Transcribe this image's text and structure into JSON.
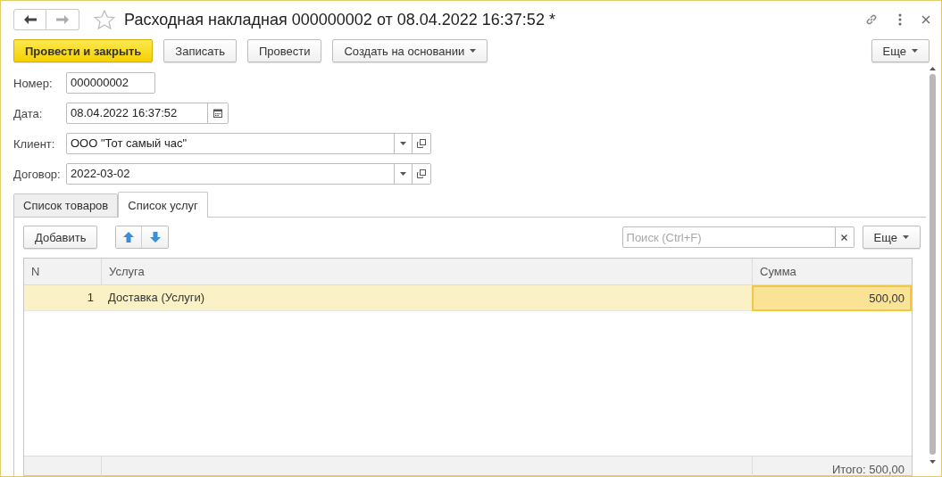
{
  "window": {
    "title": "Расходная накладная 000000002 от 08.04.2022 16:37:52 *"
  },
  "toolbar": {
    "buttons": [
      {
        "label": "Провести и закрыть",
        "kind": "primary"
      },
      {
        "label": "Записать",
        "kind": "plain"
      },
      {
        "label": "Провести",
        "kind": "plain"
      },
      {
        "label": "Создать на основании",
        "kind": "menu"
      }
    ],
    "more": "Еще"
  },
  "fields": [
    {
      "label": "Номер:",
      "value": "000000002",
      "kind": "text"
    },
    {
      "label": "Дата:",
      "value": "08.04.2022 16:37:52",
      "kind": "date"
    },
    {
      "label": "Клиент:",
      "value": "ООО \"Тот самый час\"",
      "kind": "ref"
    },
    {
      "label": "Договор:",
      "value": "2022-03-02",
      "kind": "ref"
    }
  ],
  "tabs": [
    {
      "label": "Список товаров",
      "selected": false
    },
    {
      "label": "Список услуг",
      "selected": true
    }
  ],
  "table_toolbar": {
    "add": "Добавить",
    "search": {
      "placeholder": "Поиск (Ctrl+F)"
    },
    "more": "Еще"
  },
  "table": {
    "columns": [
      "N",
      "Услуга",
      "Сумма"
    ],
    "rows": [
      {
        "cells": [
          "1",
          "Доставка (Услуги)",
          "500,00"
        ],
        "selected": true
      }
    ],
    "footer": "Итого: 500,00"
  }
}
